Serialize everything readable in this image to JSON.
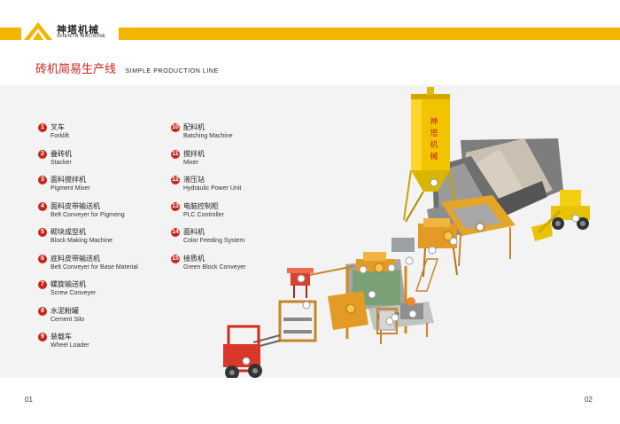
{
  "logo": {
    "cn": "神塔机械",
    "en": "SHENTA MACHINE"
  },
  "title": {
    "cn": "砖机简易生产线",
    "en": "SIMPLE PRODUCTION LINE"
  },
  "legend_left": [
    {
      "num": "1",
      "cn": "叉车",
      "en": "Forklift"
    },
    {
      "num": "2",
      "cn": "叠砖机",
      "en": "Stacker"
    },
    {
      "num": "3",
      "cn": "面料搅拌机",
      "en": "Pigment Mixer"
    },
    {
      "num": "4",
      "cn": "面料皮带输送机",
      "en": "Belt Conveyer for Pigmeng"
    },
    {
      "num": "5",
      "cn": "砌块成型机",
      "en": "Block Making Machine"
    },
    {
      "num": "6",
      "cn": "底料皮带输送机",
      "en": "Belt Conveyer for Base Material"
    },
    {
      "num": "7",
      "cn": "螺旋输送机",
      "en": "Screw Conveyer"
    },
    {
      "num": "8",
      "cn": "水泥粉罐",
      "en": "Cement Silo"
    },
    {
      "num": "9",
      "cn": "装载车",
      "en": "Wheel Loader"
    }
  ],
  "legend_right": [
    {
      "num": "10",
      "cn": "配料机",
      "en": "Batching Machine"
    },
    {
      "num": "11",
      "cn": "搅拌机",
      "en": "Mixer"
    },
    {
      "num": "12",
      "cn": "液压站",
      "en": "Hydraulic Power Unit"
    },
    {
      "num": "13",
      "cn": "电脑控制柜",
      "en": "PLC Controller"
    },
    {
      "num": "14",
      "cn": "面料机",
      "en": "Color Feeding System"
    },
    {
      "num": "15",
      "cn": "接质机",
      "en": "Green Block Conveyer"
    }
  ],
  "silo_text": [
    "神",
    "塔",
    "机",
    "械"
  ],
  "page": {
    "left": "01",
    "right": "02"
  },
  "colors": {
    "brand_yellow": "#f2b600",
    "accent_red": "#c8241c",
    "machine_orange": "#d98a1c"
  }
}
